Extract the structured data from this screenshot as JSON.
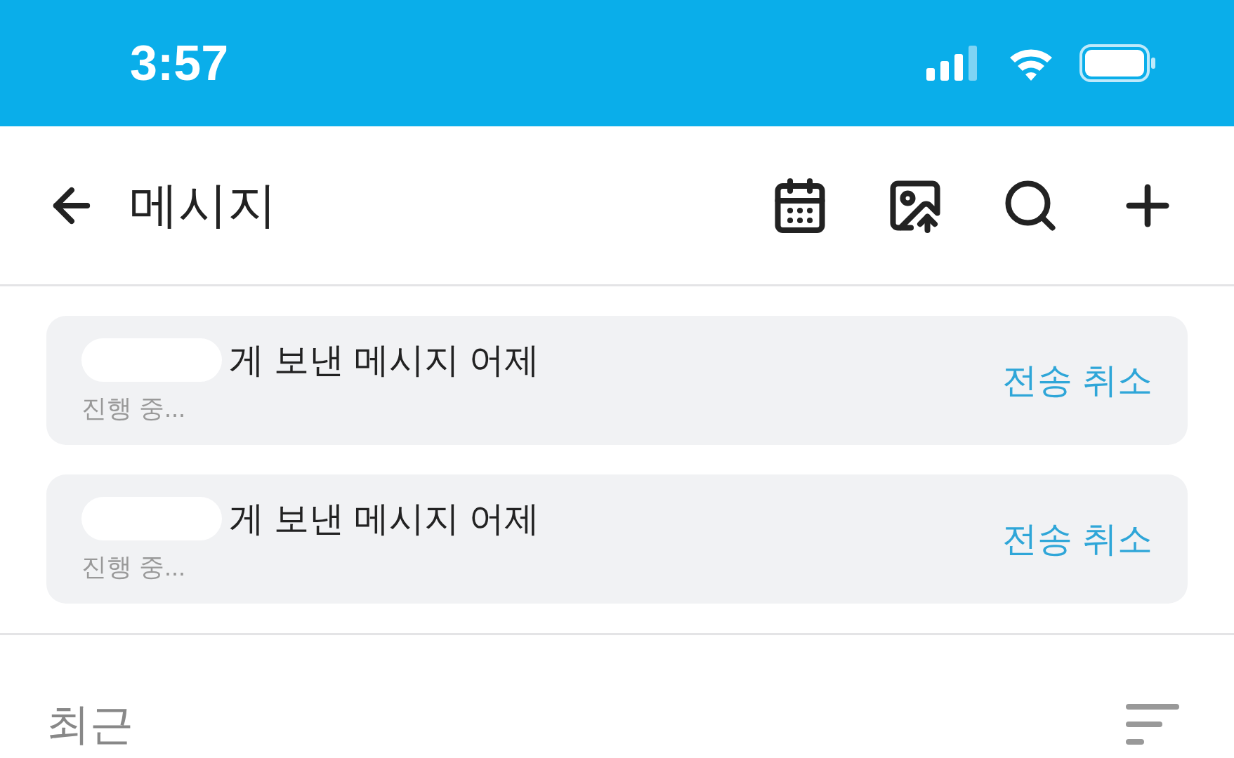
{
  "status_bar": {
    "time": "3:57"
  },
  "header": {
    "title": "메시지"
  },
  "pending_messages": [
    {
      "title": "게 보낸 메시지 어제",
      "status": "진행 중...",
      "action": "전송 취소"
    },
    {
      "title": "게 보낸 메시지 어제",
      "status": "진행 중...",
      "action": "전송 취소"
    }
  ],
  "section": {
    "title": "최근"
  }
}
